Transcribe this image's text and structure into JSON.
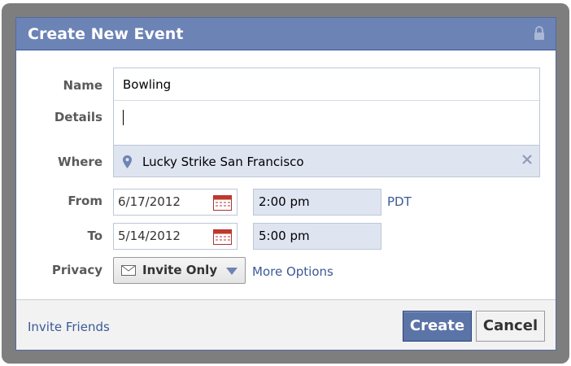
{
  "dialog": {
    "title": "Create New Event",
    "icons": {
      "lock": "lock-icon"
    }
  },
  "form": {
    "name_label": "Name",
    "name_value": "Bowling",
    "details_label": "Details",
    "details_value": "",
    "where_label": "Where",
    "where_value": "Lucky Strike San Francisco",
    "from_label": "From",
    "from_date": "6/17/2012",
    "from_time": "2:00 pm",
    "timezone": "PDT",
    "to_label": "To",
    "to_date": "5/14/2012",
    "to_time": "5:00 pm",
    "privacy_label": "Privacy",
    "privacy_value": "Invite Only",
    "more_options": "More Options"
  },
  "footer": {
    "invite_friends": "Invite Friends",
    "create_label": "Create",
    "cancel_label": "Cancel"
  },
  "colors": {
    "titlebar": "#6c83b5",
    "link": "#3b5998",
    "primary_button": "#5b74a8",
    "autocomplete_field": "#dfe4f1"
  }
}
